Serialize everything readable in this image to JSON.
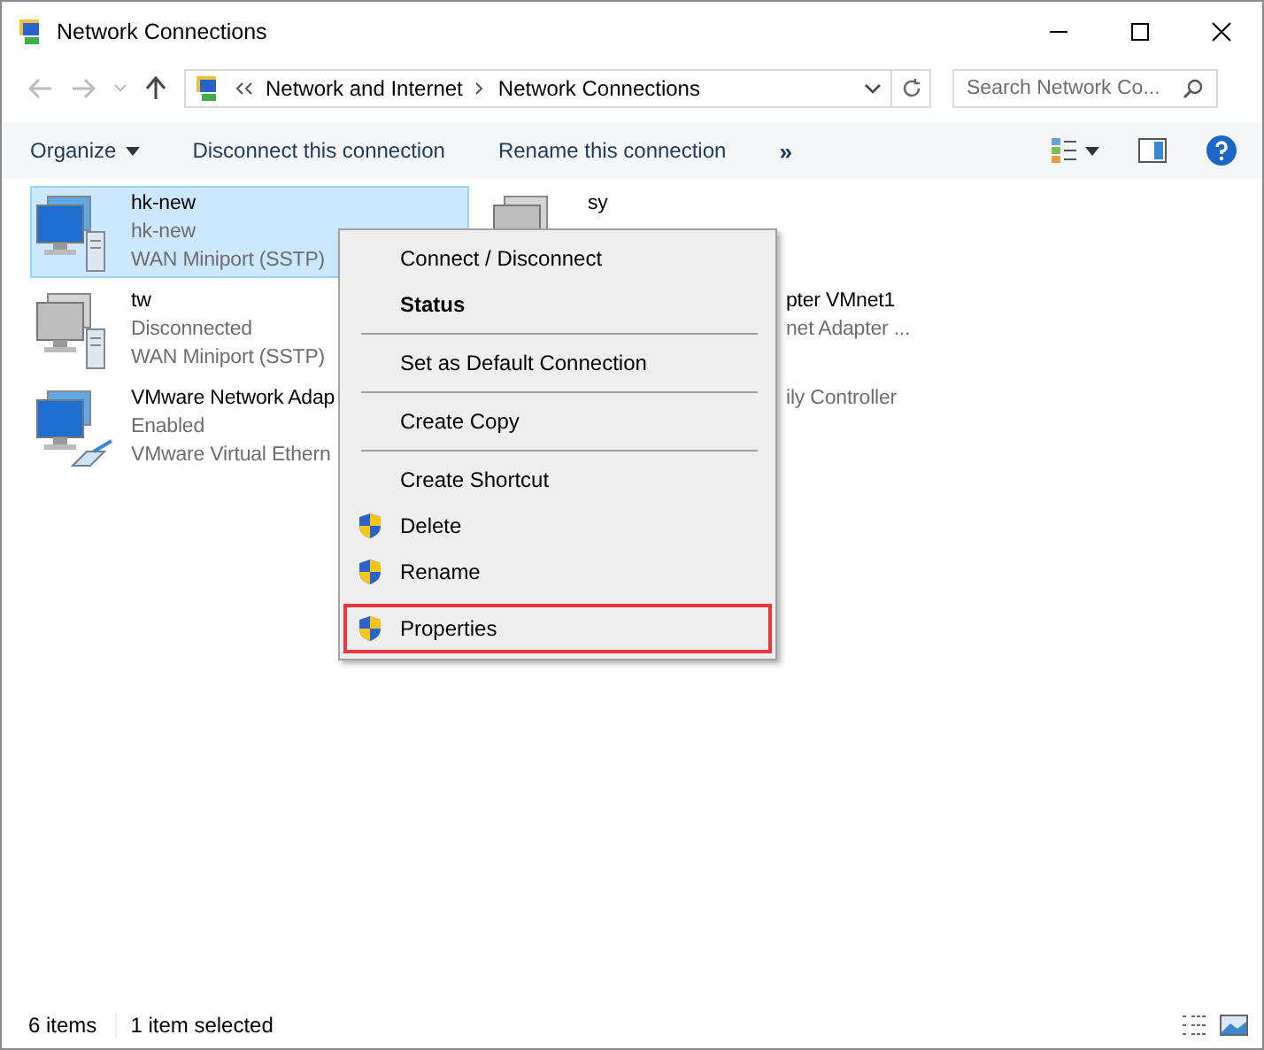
{
  "window": {
    "title": "Network Connections"
  },
  "address": {
    "crumbs": [
      "Network and Internet",
      "Network Connections"
    ]
  },
  "search": {
    "placeholder": "Search Network Co..."
  },
  "toolbar": {
    "items": [
      {
        "label": "Organize",
        "dropdown": true
      },
      {
        "label": "Disconnect this connection",
        "dropdown": false
      },
      {
        "label": "Rename this connection",
        "dropdown": false
      }
    ],
    "overflow": "»"
  },
  "columns": [
    [
      {
        "name": "hk-new",
        "status": "hk-new",
        "device": "WAN Miniport (SSTP)",
        "kind": "vpn",
        "active": true,
        "selected": true
      },
      {
        "name": "tw",
        "status": "Disconnected",
        "device": "WAN Miniport (SSTP)",
        "kind": "vpn",
        "active": false,
        "selected": false
      },
      {
        "name": "VMware Network Adap",
        "status": "Enabled",
        "device": "VMware Virtual Ethern",
        "kind": "ethernet",
        "active": true,
        "selected": false
      }
    ],
    [
      {
        "name": "sy",
        "kind": "vpn",
        "active": false,
        "selected": false
      },
      {
        "name": "pter VMnet1",
        "device": "net Adapter ...",
        "kind": "clipped",
        "selected": false
      },
      {
        "device": "ily Controller",
        "kind": "clipped",
        "selected": false
      }
    ]
  ],
  "context_menu": [
    {
      "label": "Connect / Disconnect",
      "bold": false,
      "shield": false,
      "highlighted": false,
      "separator_after": false
    },
    {
      "label": "Status",
      "bold": true,
      "shield": false,
      "highlighted": false,
      "separator_after": true
    },
    {
      "label": "Set as Default Connection",
      "bold": false,
      "shield": false,
      "highlighted": false,
      "separator_after": true
    },
    {
      "label": "Create Copy",
      "bold": false,
      "shield": false,
      "highlighted": false,
      "separator_after": true
    },
    {
      "label": "Create Shortcut",
      "bold": false,
      "shield": false,
      "highlighted": false,
      "separator_after": false
    },
    {
      "label": "Delete",
      "bold": false,
      "shield": true,
      "highlighted": false,
      "separator_after": false
    },
    {
      "label": "Rename",
      "bold": false,
      "shield": true,
      "highlighted": false,
      "separator_after": false
    },
    {
      "label": "Properties",
      "bold": false,
      "shield": true,
      "highlighted": true,
      "separator_after": false
    }
  ],
  "status_bar": {
    "count": "6 items",
    "selection": "1 item selected"
  }
}
